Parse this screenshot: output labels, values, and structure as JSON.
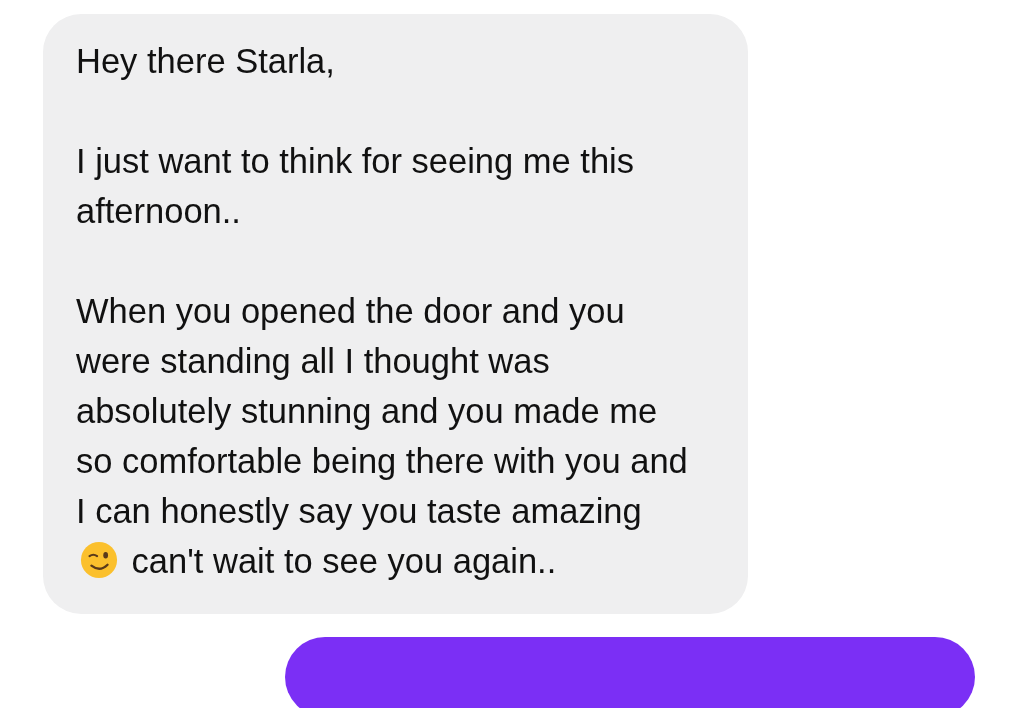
{
  "messages": [
    {
      "kind": "incoming",
      "greeting": "Hey there Starla,",
      "paragraphs": [
        [
          {
            "kind": "text",
            "text": "I just want to think for seeing me this afternoon.."
          }
        ],
        [
          {
            "kind": "text",
            "text": "When you opened the door and you were standing all I thought was absolutely stunning and you made me so comfortable being there with you and I can honestly say you taste amazing"
          },
          {
            "kind": "wink"
          },
          {
            "kind": "text",
            "text": "can't wait to see you again.."
          }
        ]
      ]
    },
    {
      "kind": "outgoing"
    }
  ]
}
